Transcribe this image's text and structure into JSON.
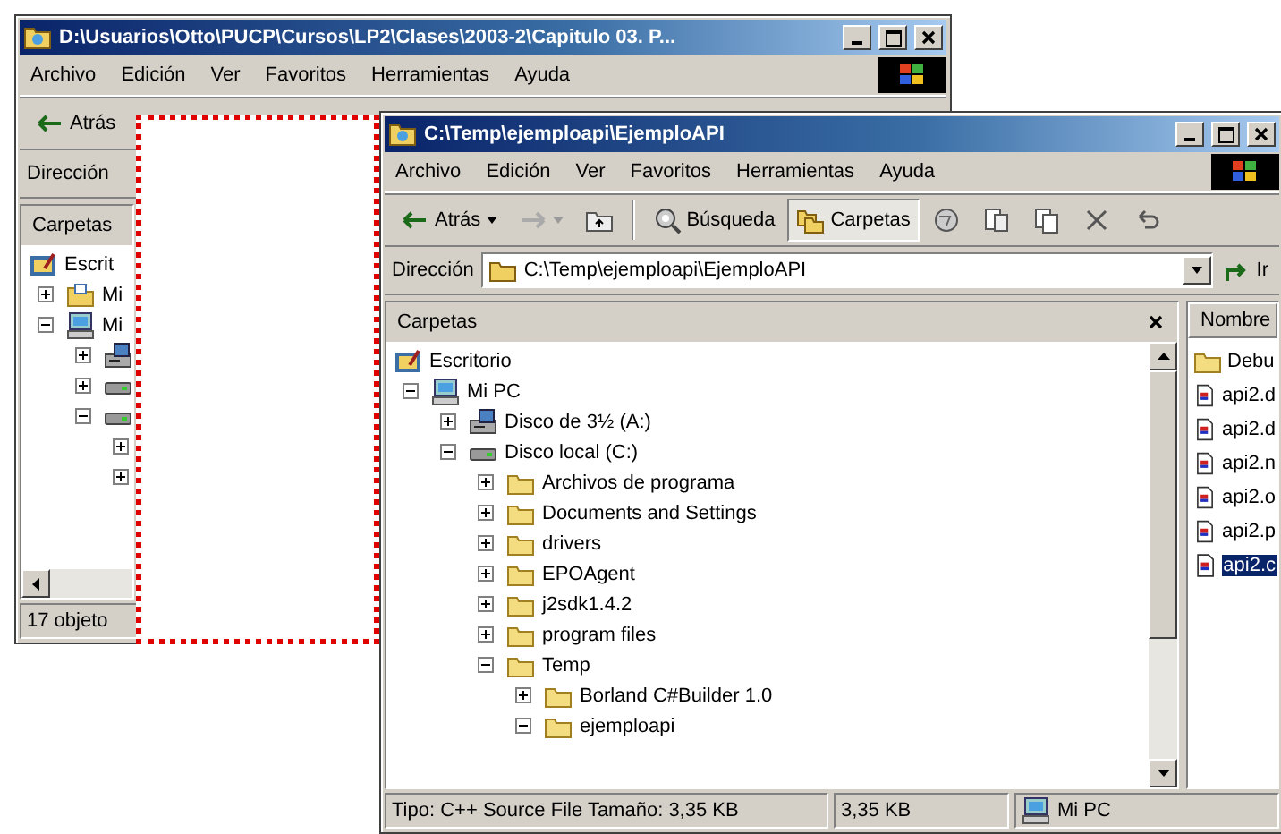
{
  "back_window": {
    "title": "D:\\Usuarios\\Otto\\PUCP\\Cursos\\LP2\\Clases\\2003-2\\Capitulo 03. P...",
    "menu": [
      "Archivo",
      "Edición",
      "Ver",
      "Favoritos",
      "Herramientas",
      "Ayuda"
    ],
    "back_button": "Atrás",
    "address_label": "Dirección",
    "pane_title": "Carpetas",
    "tree": {
      "kind": "desktop",
      "label": "Escrit",
      "children": [
        {
          "kind": "mydocs",
          "label": "Mi",
          "expanded": false
        },
        {
          "kind": "computer",
          "label": "Mi",
          "expanded": true,
          "children": [
            {
              "kind": "floppy",
              "expanded": false
            },
            {
              "kind": "drive",
              "expanded": false
            },
            {
              "kind": "drive",
              "expanded": true,
              "children": [
                {
                  "expanded": false
                },
                {
                  "expanded": false
                }
              ]
            }
          ]
        }
      ]
    },
    "status": "17 objeto"
  },
  "front_window": {
    "title": "C:\\Temp\\ejemploapi\\EjemploAPI",
    "menu": [
      "Archivo",
      "Edición",
      "Ver",
      "Favoritos",
      "Herramientas",
      "Ayuda"
    ],
    "toolbar": [
      {
        "kind": "back",
        "label": "Atrás",
        "selected": false
      },
      {
        "kind": "forward",
        "selected": false
      },
      {
        "kind": "up",
        "selected": false
      },
      {
        "kind": "search",
        "label": "Búsqueda",
        "selected": false
      },
      {
        "kind": "folders",
        "label": "Carpetas",
        "selected": true
      },
      {
        "kind": "history",
        "selected": false
      },
      {
        "kind": "move",
        "selected": false
      },
      {
        "kind": "copy",
        "selected": false
      },
      {
        "kind": "delete",
        "selected": false
      },
      {
        "kind": "undo",
        "selected": false
      }
    ],
    "address": {
      "label": "Dirección",
      "value": "C:\\Temp\\ejemploapi\\EjemploAPI",
      "go": "Ir"
    },
    "pane_title": "Carpetas",
    "tree": {
      "kind": "desktop",
      "label": "Escritorio",
      "children": [
        {
          "kind": "computer",
          "label": "Mi PC",
          "expanded": true,
          "children": [
            {
              "kind": "floppy",
              "label": "Disco de 3½ (A:)",
              "expanded": false
            },
            {
              "kind": "drive",
              "label": "Disco local (C:)",
              "expanded": true,
              "children": [
                {
                  "kind": "folder",
                  "label": "Archivos de programa",
                  "expanded": false
                },
                {
                  "kind": "folder",
                  "label": "Documents and Settings",
                  "expanded": false
                },
                {
                  "kind": "folder",
                  "label": "drivers",
                  "expanded": false
                },
                {
                  "kind": "folder",
                  "label": "EPOAgent",
                  "expanded": false
                },
                {
                  "kind": "folder",
                  "label": "j2sdk1.4.2",
                  "expanded": false
                },
                {
                  "kind": "folder",
                  "label": "program files",
                  "expanded": false
                },
                {
                  "kind": "folder",
                  "label": "Temp",
                  "expanded": true,
                  "children": [
                    {
                      "kind": "folder",
                      "label": "Borland C#Builder 1.0",
                      "expanded": false
                    },
                    {
                      "kind": "folder",
                      "label": "ejemploapi",
                      "expanded": true
                    }
                  ]
                }
              ]
            }
          ]
        }
      ]
    },
    "files_header": "Nombre",
    "files": [
      {
        "kind": "folder",
        "name": "Debu",
        "selected": false
      },
      {
        "kind": "file",
        "name": "api2.d",
        "selected": false
      },
      {
        "kind": "file",
        "name": "api2.d",
        "selected": false
      },
      {
        "kind": "file",
        "name": "api2.n",
        "selected": false
      },
      {
        "kind": "file",
        "name": "api2.o",
        "selected": false
      },
      {
        "kind": "file",
        "name": "api2.p",
        "selected": false
      },
      {
        "kind": "file",
        "name": "api2.c",
        "selected": true
      }
    ],
    "status": {
      "info": "Tipo: C++ Source File Tamaño: 3,35 KB",
      "size": "3,35 KB",
      "zone": "Mi PC"
    }
  }
}
